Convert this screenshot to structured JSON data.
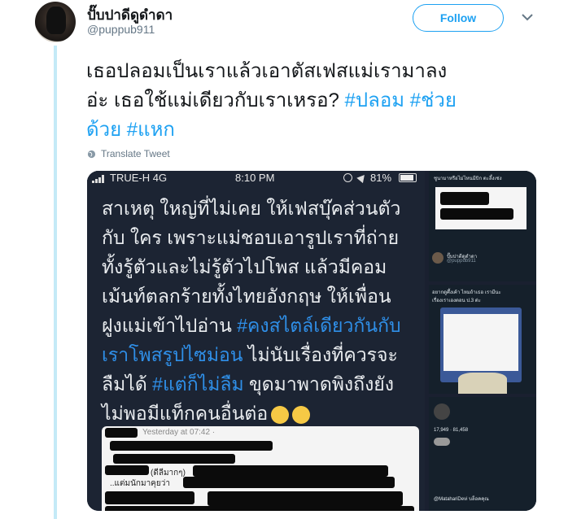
{
  "user": {
    "display_name": "ปั๊บปาดีดูดำดา",
    "handle": "@puppub911"
  },
  "follow_label": "Follow",
  "tweet": {
    "line1": "เธอปลอมเป็นเราแล้วเอาตัสเฟสแม่เรามาลง",
    "line2_text": "อ่ะ เธอใช้แม่เดียวกับเราเหรอ? ",
    "tag1": "#ปลอม",
    "tag2": "#ช่วย",
    "line3_tag": "ด้วย",
    "tag3": "#แหก"
  },
  "translate_label": "Translate Tweet",
  "screenshot": {
    "status": {
      "carrier": "TRUE-H  4G",
      "time": "8:10 PM",
      "battery": "81%"
    },
    "text_lines": {
      "l1": "สาเหตุ ใหญ่ที่ไม่เคย ให้เฟสบุ๊คส่วนตัว",
      "l2": "กับ ใคร เพราะแม่ชอบเอารูปเราที่ถ่าย",
      "l3": "ทั้งรู้ตัวและไม่รู้ตัวไปโพส แล้วมีคอม",
      "l4": "เม้นท์ตลกร้ายทั้งไทยอังกฤษ ให้เพื่อน",
      "l5_pre": "ฝูงแม่เข้าไปอ่าน ",
      "l5_tag": "#คงสไตล์เดียวกันกับ",
      "l6_tag": "เราโพสรูปไซม่อน",
      "l6_post": " ไม่นับเรื่องที่ควรจะ",
      "l7_pre": "ลืมได้ ",
      "l7_tag": "#แต่ก็ไม่ลืม",
      "l7_post": " ขุดมาพาดพิงถึงยัง",
      "l8": "ไม่พอมีแท็กคนอื่นต่อ"
    },
    "card": {
      "timestamp": "Yesterday at 07:42 ·",
      "line_a": "(ดีลีมากๆ)",
      "line_b": "..แต่มนักมาคุยว่า"
    }
  },
  "side_panels": {
    "p1_text": "ชูนามาหรือไม่ไหนมีบิก ตะลึ้งเช่ง",
    "p1_name": "ปั๊บปาดีดูดำดา",
    "p1_handle": "@puppub911",
    "p2_text": "อยากดูศึ้งเค้า ไหมถ้าเธอ เรามีนะ",
    "p2_sub": "เรื่องเราเองตอน ป.3 ด่ะ",
    "p3_stats": "17,949 · 81,458",
    "p3_handle": "@MatahariDevi บล็อคคุณ"
  },
  "colors": {
    "accent": "#1da1f2",
    "thread_line": "#c4eaf7",
    "phone_bg": "#1c2433",
    "hashtag_in_image": "#2f8fe8"
  },
  "icons": [
    "chevron-down-icon",
    "globe-icon",
    "signal-icon",
    "alarm-icon",
    "location-icon",
    "battery-icon",
    "emoji-sleepy-icon",
    "emoji-crying-icon"
  ]
}
